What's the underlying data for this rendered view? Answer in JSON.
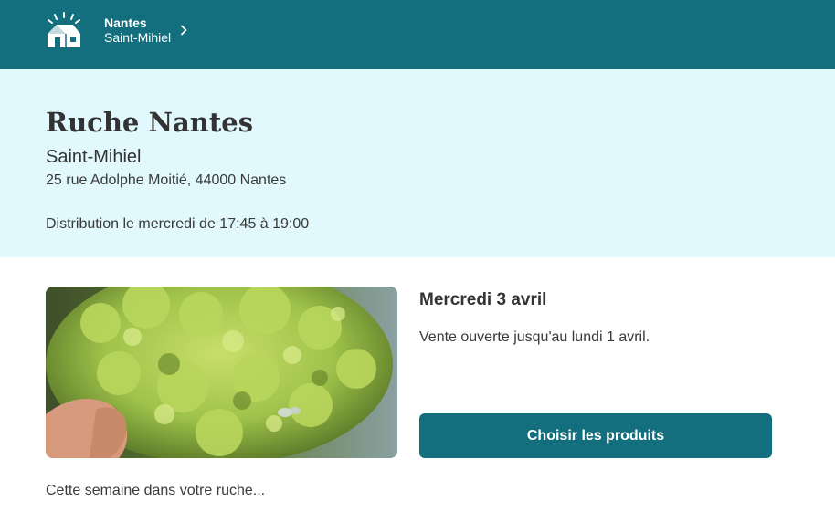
{
  "header": {
    "city": "Nantes",
    "hive_name": "Saint-Mihiel",
    "logo_icon": "hive-house-icon",
    "chevron_icon": "chevron-right-icon"
  },
  "hive": {
    "title": "Ruche Nantes",
    "subtitle": "Saint-Mihiel",
    "address": "25 rue Adolphe Moitié, 44000 Nantes",
    "distribution": "Distribution le mercredi de 17:45 à 19:00"
  },
  "sale": {
    "date": "Mercredi 3 avril",
    "status": "Vente ouverte jusqu'au lundi 1 avril.",
    "button_label": "Choisir les produits"
  },
  "week": {
    "intro": "Cette semaine dans votre ruche..."
  },
  "colors": {
    "brand": "#136f7d",
    "info_band": "#e1f9fc",
    "text": "#333333"
  }
}
